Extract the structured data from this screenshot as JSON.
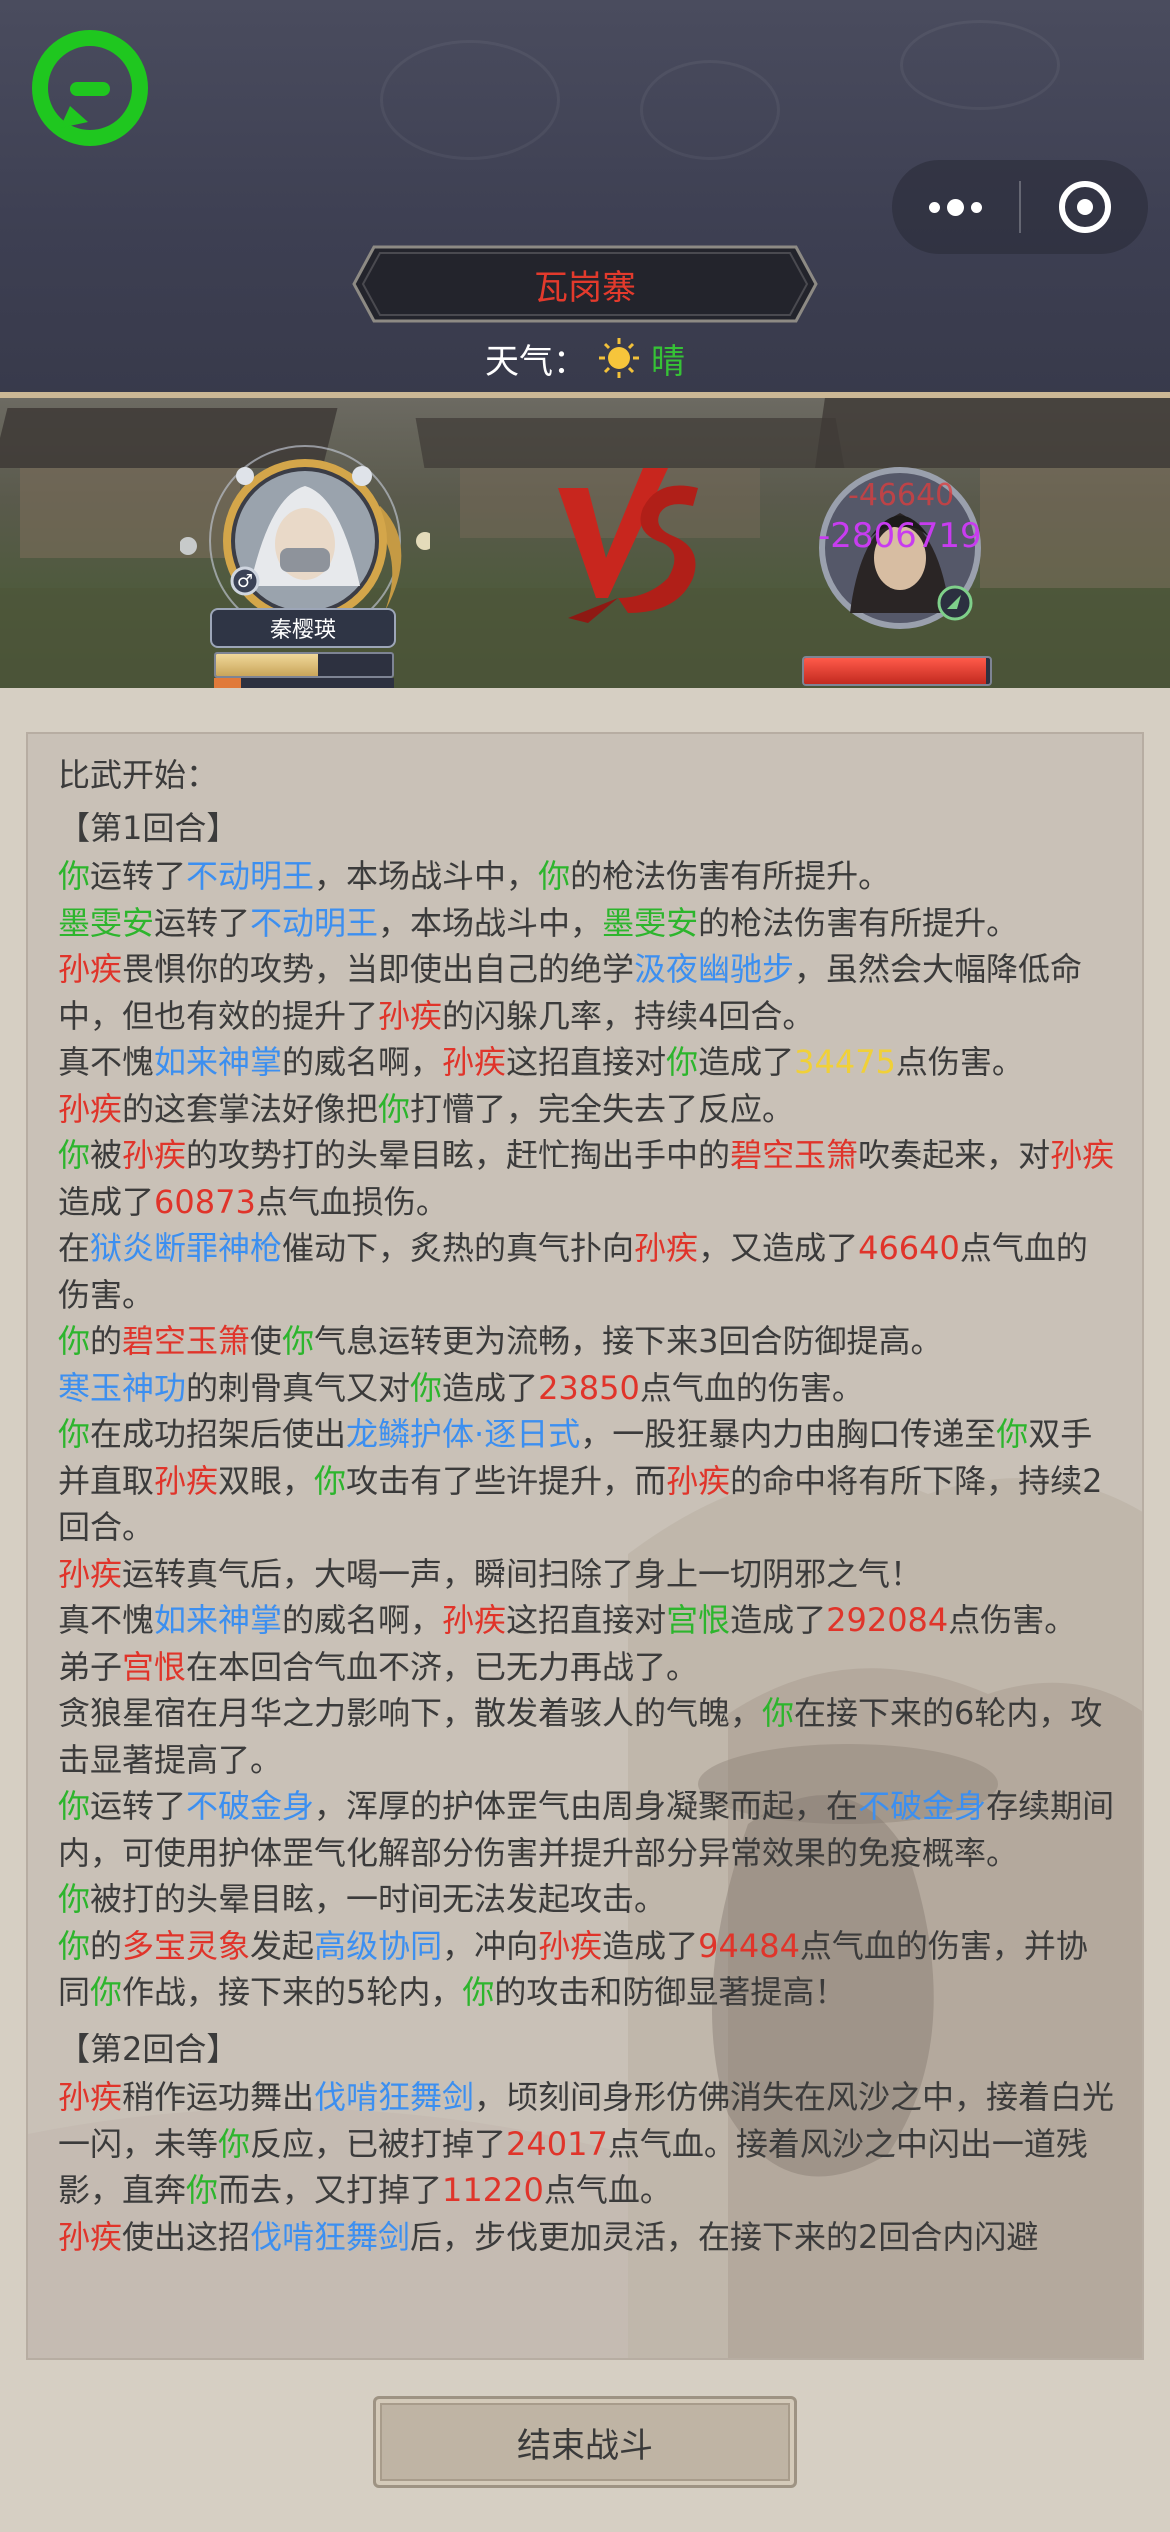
{
  "header": {
    "location": "瓦岗寨",
    "weather_label": "天气：",
    "weather_value": "晴"
  },
  "battle": {
    "player": {
      "name": "秦樱瑛",
      "hp_fraction": 0.58,
      "mp_fraction": 0.15
    },
    "enemy": {
      "hp_fraction": 0.98
    },
    "damage_top": "-46640",
    "damage_bottom": "-2806719"
  },
  "log": {
    "intro": "比武开始：",
    "round1_title": "【第1回合】",
    "round2_title": "【第2回合】",
    "lines": [
      [
        [
          "你",
          "g"
        ],
        [
          "运转了",
          ""
        ],
        [
          "不动明王",
          "b"
        ],
        [
          "，本场战斗中，",
          ""
        ],
        [
          "你",
          "g"
        ],
        [
          "的枪法伤害有所提升。",
          ""
        ]
      ],
      [
        [
          "墨雯安",
          "g"
        ],
        [
          "运转了",
          ""
        ],
        [
          "不动明王",
          "b"
        ],
        [
          "，本场战斗中，",
          ""
        ],
        [
          "墨雯安",
          "g"
        ],
        [
          "的枪法伤害有所提升。",
          ""
        ]
      ],
      [
        [
          "孙疾",
          "r"
        ],
        [
          "畏惧你的攻势，当即使出自己的绝学",
          ""
        ],
        [
          "汲夜幽驰步",
          "b"
        ],
        [
          "，虽然会大幅降低命中，但也有效的提升了",
          ""
        ],
        [
          "孙疾",
          "r"
        ],
        [
          "的闪躲几率，持续4回合。",
          ""
        ]
      ],
      [
        [
          "真不愧",
          ""
        ],
        [
          "如来神掌",
          "b"
        ],
        [
          "的威名啊，",
          ""
        ],
        [
          "孙疾",
          "r"
        ],
        [
          "这招直接对",
          ""
        ],
        [
          "你",
          "g"
        ],
        [
          "造成了",
          ""
        ],
        [
          "34475",
          "y"
        ],
        [
          "点伤害。",
          ""
        ]
      ],
      [
        [
          "孙疾",
          "r"
        ],
        [
          "的这套掌法好像把",
          ""
        ],
        [
          "你",
          "g"
        ],
        [
          "打懵了，完全失去了反应。",
          ""
        ]
      ],
      [
        [
          "你",
          "g"
        ],
        [
          "被",
          ""
        ],
        [
          "孙疾",
          "r"
        ],
        [
          "的攻势打的头晕目眩，赶忙掏出手中的",
          ""
        ],
        [
          "碧空玉箫",
          "r"
        ],
        [
          "吹奏起来，对",
          ""
        ],
        [
          "孙疾",
          "r"
        ],
        [
          "造成了",
          ""
        ],
        [
          "60873",
          "r"
        ],
        [
          "点气血损伤。",
          ""
        ]
      ],
      [
        [
          "在",
          ""
        ],
        [
          "狱炎断罪神枪",
          "b"
        ],
        [
          "催动下，炙热的真气扑向",
          ""
        ],
        [
          "孙疾",
          "r"
        ],
        [
          "，又造成了",
          ""
        ],
        [
          "46640",
          "r"
        ],
        [
          "点气血的伤害。",
          ""
        ]
      ],
      [
        [
          "你",
          "g"
        ],
        [
          "的",
          ""
        ],
        [
          "碧空玉箫",
          "r"
        ],
        [
          "使",
          ""
        ],
        [
          "你",
          "g"
        ],
        [
          "气息运转更为流畅，接下来3回合防御提高。",
          ""
        ]
      ],
      [
        [
          "寒玉神功",
          "b"
        ],
        [
          "的刺骨真气又对",
          ""
        ],
        [
          "你",
          "g"
        ],
        [
          "造成了",
          ""
        ],
        [
          "23850",
          "r"
        ],
        [
          "点气血的伤害。",
          ""
        ]
      ],
      [
        [
          "你",
          "g"
        ],
        [
          "在成功招架后使出",
          ""
        ],
        [
          "龙鳞护体·逐日式",
          "b"
        ],
        [
          "，一股狂暴内力由胸口传递至",
          ""
        ],
        [
          "你",
          "g"
        ],
        [
          "双手并直取",
          ""
        ],
        [
          "孙疾",
          "r"
        ],
        [
          "双眼，",
          ""
        ],
        [
          "你",
          "g"
        ],
        [
          "攻击有了些许提升，而",
          ""
        ],
        [
          "孙疾",
          "r"
        ],
        [
          "的命中将有所下降，持续2回合。",
          ""
        ]
      ],
      [
        [
          "孙疾",
          "r"
        ],
        [
          "运转真气后，大喝一声，瞬间扫除了身上一切阴邪之气！",
          ""
        ]
      ],
      [
        [
          "真不愧",
          ""
        ],
        [
          "如来神掌",
          "b"
        ],
        [
          "的威名啊，",
          ""
        ],
        [
          "孙疾",
          "r"
        ],
        [
          "这招直接对",
          ""
        ],
        [
          "宫恨",
          "g"
        ],
        [
          "造成了",
          ""
        ],
        [
          "292084",
          "r"
        ],
        [
          "点伤害。",
          ""
        ]
      ],
      [
        [
          "弟子",
          ""
        ],
        [
          "宫恨",
          "r"
        ],
        [
          "在本回合气血不济，已无力再战了。",
          ""
        ]
      ],
      [
        [
          "贪狼星宿在月华之力影响下，散发着骇人的气魄，",
          ""
        ],
        [
          "你",
          "g"
        ],
        [
          "在接下来的6轮内，攻击显著提高了。",
          ""
        ]
      ],
      [
        [
          "你",
          "g"
        ],
        [
          "运转了",
          ""
        ],
        [
          "不破金身",
          "b"
        ],
        [
          "，浑厚的护体罡气由周身凝聚而起，在",
          ""
        ],
        [
          "不破金身",
          "b"
        ],
        [
          "存续期间内，可使用护体罡气化解部分伤害并提升部分异常效果的免疫概率。",
          ""
        ]
      ],
      [
        [
          "你",
          "g"
        ],
        [
          "被打的头晕目眩，一时间无法发起攻击。",
          ""
        ]
      ],
      [
        [
          "你",
          "g"
        ],
        [
          "的",
          ""
        ],
        [
          "多宝灵象",
          "r"
        ],
        [
          "发起",
          ""
        ],
        [
          "高级协同",
          "b"
        ],
        [
          "，冲向",
          ""
        ],
        [
          "孙疾",
          "r"
        ],
        [
          "造成了",
          ""
        ],
        [
          "94484",
          "r"
        ],
        [
          "点气血的伤害，并协同",
          ""
        ],
        [
          "你",
          "g"
        ],
        [
          "作战，接下来的5轮内，",
          ""
        ],
        [
          "你",
          "g"
        ],
        [
          "的攻击和防御显著提高！",
          ""
        ]
      ]
    ],
    "lines2": [
      [
        [
          "孙疾",
          "r"
        ],
        [
          "稍作运功舞出",
          ""
        ],
        [
          "伐啃狂舞剑",
          "b"
        ],
        [
          "，顷刻间身形仿佛消失在风沙之中，接着白光一闪，未等",
          ""
        ],
        [
          "你",
          "g"
        ],
        [
          "反应，已被打掉了",
          ""
        ],
        [
          "24017",
          "r"
        ],
        [
          "点气血。接着风沙之中闪出一道残影，直奔",
          ""
        ],
        [
          "你",
          "g"
        ],
        [
          "而去，又打掉了",
          ""
        ],
        [
          "11220",
          "r"
        ],
        [
          "点气血。",
          ""
        ]
      ],
      [
        [
          "孙疾",
          "r"
        ],
        [
          "使出这招",
          ""
        ],
        [
          "伐啃狂舞剑",
          "b"
        ],
        [
          "后，步伐更加灵活，在接下来的2回合内闪避",
          ""
        ]
      ]
    ]
  },
  "footer": {
    "end_button": "结束战斗"
  },
  "colors": {
    "green": "#2db52d",
    "blue": "#3c8ff0",
    "red": "#e0342a",
    "yellow": "#f0d038"
  }
}
